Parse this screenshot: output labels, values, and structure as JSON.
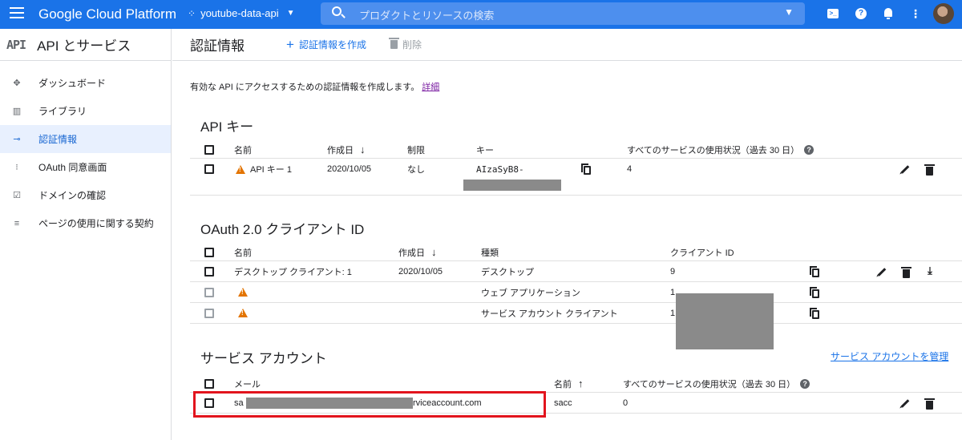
{
  "topbar": {
    "brand": "Google Cloud Platform",
    "project": "youtube-data-api",
    "search_placeholder": "プロダクトとリソースの検索",
    "icons": [
      "cloud-shell-icon",
      "help-icon",
      "notifications-icon",
      "more-vert-icon"
    ]
  },
  "sidebar": {
    "logo": "API",
    "title": "API とサービス",
    "items": [
      {
        "label": "ダッシュボード",
        "icon": "dashboard-icon"
      },
      {
        "label": "ライブラリ",
        "icon": "library-icon"
      },
      {
        "label": "認証情報",
        "icon": "key-icon",
        "active": true
      },
      {
        "label": "OAuth 同意画面",
        "icon": "consent-icon"
      },
      {
        "label": "ドメインの確認",
        "icon": "checkbox-icon"
      },
      {
        "label": "ページの使用に関する契約",
        "icon": "settings-list-icon"
      }
    ]
  },
  "header": {
    "title": "認証情報",
    "create": "認証情報を作成",
    "delete": "削除"
  },
  "description": {
    "text": "有効な API にアクセスするための認証情報を作成します。",
    "link": "詳細"
  },
  "api_keys": {
    "title": "API キー",
    "columns": {
      "name": "名前",
      "created": "作成日",
      "restriction": "制限",
      "key": "キー",
      "usage": "すべてのサービスの使用状況（過去 30 日）"
    },
    "rows": [
      {
        "name": "API キー 1",
        "created": "2020/10/05",
        "restriction": "なし",
        "key": "AIzaSyB8-",
        "usage": "4"
      }
    ]
  },
  "oauth": {
    "title": "OAuth 2.0 クライアント ID",
    "columns": {
      "name": "名前",
      "created": "作成日",
      "type": "種類",
      "client_id": "クライアント ID"
    },
    "rows": [
      {
        "name": "デスクトップ クライアント: 1",
        "created": "2020/10/05",
        "type": "デスクトップ",
        "client_id": "9",
        "warning": false
      },
      {
        "name": "",
        "created": "",
        "type": "ウェブ アプリケーション",
        "client_id": "1",
        "warning": true
      },
      {
        "name": "",
        "created": "",
        "type": "サービス アカウント クライアント",
        "client_id": "1",
        "warning": true
      }
    ]
  },
  "service_accounts": {
    "title": "サービス アカウント",
    "manage_link": "サービス アカウントを管理",
    "columns": {
      "email": "メール",
      "name": "名前",
      "usage": "すべてのサービスの使用状況（過去 30 日）"
    },
    "rows": [
      {
        "email_start": "sa",
        "email_end": "rviceaccount.com",
        "name": "sacc",
        "usage": "0"
      }
    ]
  }
}
